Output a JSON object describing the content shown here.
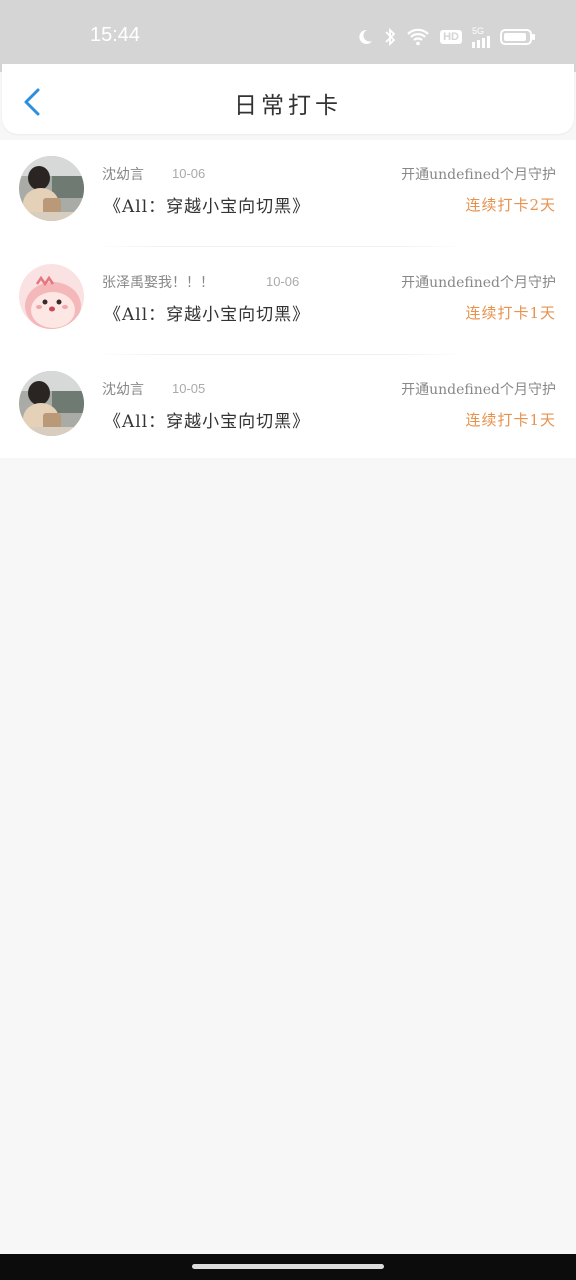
{
  "status_bar": {
    "time": "15:44",
    "network": "5G",
    "hd": "HD"
  },
  "header": {
    "title": "日常打卡"
  },
  "checkins": [
    {
      "username": "沈幼言",
      "date": "10-06",
      "book": "《All：穿越小宝向切黑》",
      "guard": "开通undefined个月守护",
      "streak": "连续打卡2天",
      "avatar": "girl-photo"
    },
    {
      "username": "张泽禹娶我！！！",
      "date": "10-06",
      "book": "《All：穿越小宝向切黑》",
      "guard": "开通undefined个月守护",
      "streak": "连续打卡1天",
      "avatar": "pink-cartoon"
    },
    {
      "username": "沈幼言",
      "date": "10-05",
      "book": "《All：穿越小宝向切黑》",
      "guard": "开通undefined个月守护",
      "streak": "连续打卡1天",
      "avatar": "girl-photo"
    }
  ],
  "colors": {
    "accent": "#2b8fe0",
    "streak": "#e8924e",
    "status_bar": "#d5d5d5",
    "background": "#f8f7f7"
  }
}
